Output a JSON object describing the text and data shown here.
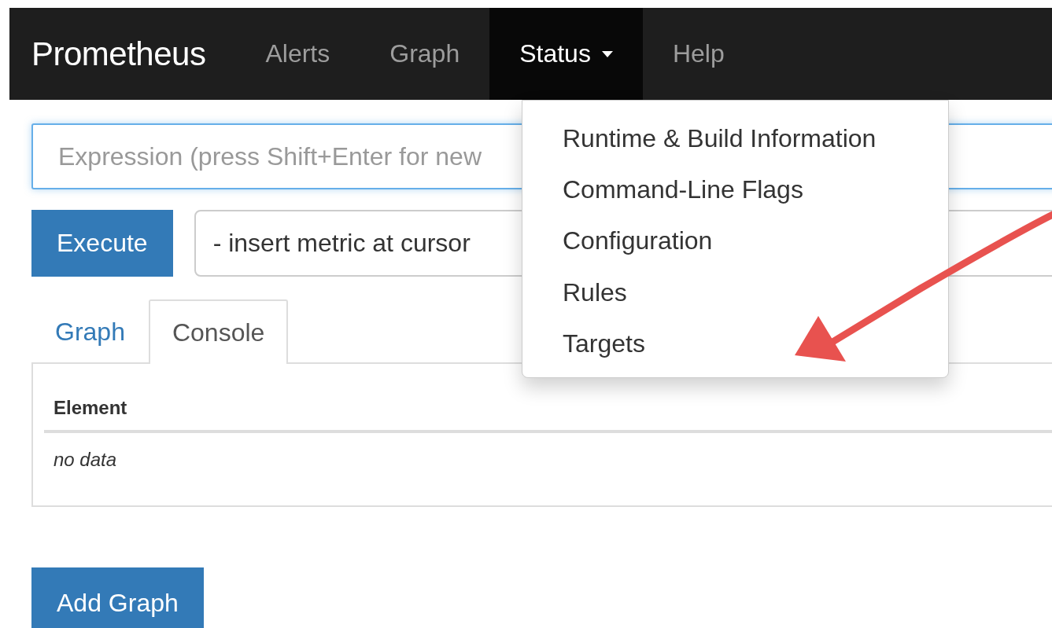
{
  "navbar": {
    "brand": "Prometheus",
    "items": [
      {
        "label": "Alerts",
        "selected": false,
        "dropdown": false
      },
      {
        "label": "Graph",
        "selected": false,
        "dropdown": false
      },
      {
        "label": "Status",
        "selected": true,
        "dropdown": true
      },
      {
        "label": "Help",
        "selected": false,
        "dropdown": false
      }
    ]
  },
  "status_menu": {
    "expanded": true,
    "items": [
      "Runtime & Build Information",
      "Command-Line Flags",
      "Configuration",
      "Rules",
      "Targets"
    ]
  },
  "expression": {
    "placeholder": "Expression (press Shift+Enter for new"
  },
  "execute_button": "Execute",
  "metric_select": {
    "value": "- insert metric at cursor"
  },
  "tabs": [
    {
      "label": "Graph",
      "selected": false
    },
    {
      "label": "Console",
      "selected": true
    }
  ],
  "table": {
    "columns": [
      "Element"
    ],
    "empty_text": "no data"
  },
  "add_graph_button": "Add Graph",
  "annotations": [
    {
      "kind": "arrow"
    }
  ]
}
